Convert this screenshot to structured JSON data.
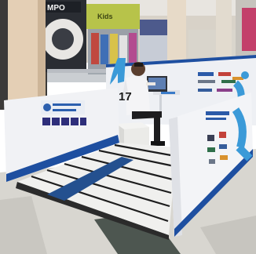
{
  "photo": {
    "mall_sign_fragment": "MPO",
    "store_sign_fragment": "Kids",
    "jersey_number": "17"
  },
  "colors": {
    "floor_light": "#d9d7d1",
    "floor_dark": "#4f5a52",
    "booth_white": "#f2f3f6",
    "booth_blue": "#1e4fa0",
    "accent_cyan": "#3b9ad8",
    "column": "#e9d5bd",
    "ceiling": "#e7e4df"
  }
}
